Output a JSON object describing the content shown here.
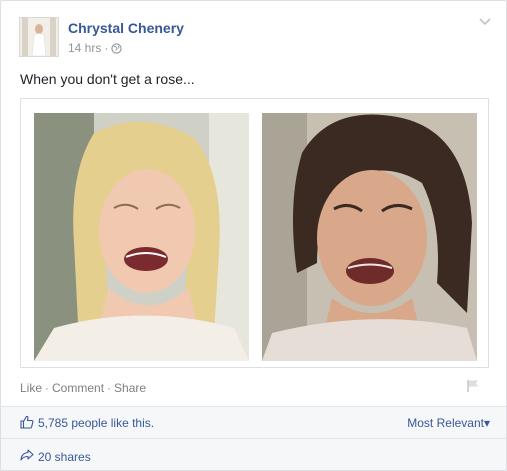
{
  "post": {
    "author": "Chrystal Chenery",
    "time": "14 hrs",
    "dot": "·",
    "message": "When you don't get a rose..."
  },
  "actions": {
    "like": "Like",
    "comment": "Comment",
    "share": "Share",
    "separator": "·"
  },
  "likes": {
    "text": "5,785 people like this.",
    "sort": "Most Relevant",
    "sort_arrow": "▾"
  },
  "shares": {
    "text": "20 shares"
  },
  "icons": {
    "options": "chevron-down-icon",
    "privacy": "globe-icon",
    "report": "flag-icon",
    "like": "thumbs-up-icon",
    "share": "share-arrow-icon"
  },
  "colors": {
    "link": "#365899",
    "meta": "#90949c",
    "text": "#1d2129",
    "panel": "#f6f7f9"
  }
}
